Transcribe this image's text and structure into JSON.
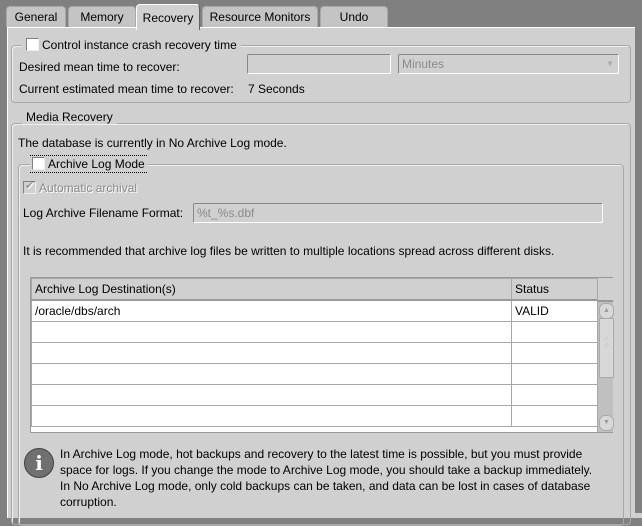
{
  "tabs": [
    {
      "label": "General",
      "active": false
    },
    {
      "label": "Memory",
      "active": false
    },
    {
      "label": "Recovery",
      "active": true
    },
    {
      "label": "Resource Monitors",
      "active": false
    },
    {
      "label": "Undo",
      "active": false
    }
  ],
  "crash_recovery": {
    "checkbox_label": "Control instance crash recovery time",
    "checked": false,
    "desired_label": "Desired mean time to recover:",
    "desired_value": "",
    "unit_select": "Minutes",
    "current_label": "Current estimated mean time to recover:",
    "current_value": "7 Seconds"
  },
  "media_recovery": {
    "legend": "Media Recovery",
    "status_text": "The database is currently in No Archive Log mode.",
    "archive_log_mode_label": "Archive Log Mode",
    "archive_log_mode_checked": false,
    "automatic_archival_label": "Automatic archival",
    "automatic_archival_checked": true,
    "filename_format_label": "Log Archive Filename Format:",
    "filename_format_value": "%t_%s.dbf",
    "recommendation": "It is recommended that archive log files be written to multiple locations spread across different disks.",
    "table": {
      "columns": [
        "Archive Log Destination(s)",
        "Status"
      ],
      "rows": [
        [
          "/oracle/dbs/arch",
          "VALID"
        ],
        [
          "",
          ""
        ],
        [
          "",
          ""
        ],
        [
          "",
          ""
        ],
        [
          "",
          ""
        ],
        [
          "",
          ""
        ]
      ]
    },
    "info_lines": [
      "In Archive Log mode, hot backups and recovery to the latest time is possible, but you must provide",
      "space for logs. If you change the mode to Archive Log mode, you should take a backup immediately.",
      "In No Archive Log mode, only cold backups can be taken, and data can be lost in cases of database",
      "corruption."
    ]
  }
}
